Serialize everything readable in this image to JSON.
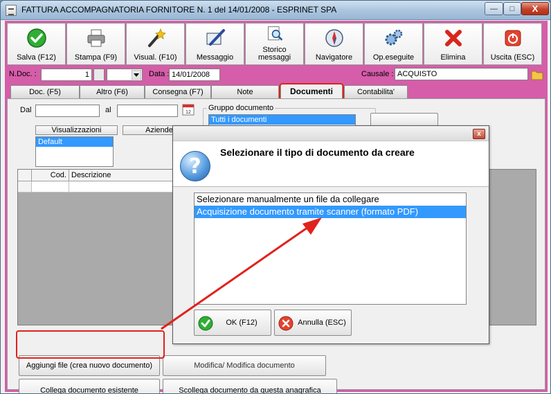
{
  "window": {
    "title": "FATTURA ACCOMPAGNATORIA FORNITORE N. 1  del 14/01/2008 - ESPRINET SPA",
    "minimize_glyph": "—",
    "maximize_glyph": "□",
    "close_glyph": "X"
  },
  "toolbar": {
    "items": [
      {
        "label": "Salva (F12)",
        "icon": "checkmark-icon"
      },
      {
        "label": "Stampa (F9)",
        "icon": "printer-icon"
      },
      {
        "label": "Visual. (F10)",
        "icon": "magic-wand-icon"
      },
      {
        "label": "Messaggio",
        "icon": "pen-icon"
      },
      {
        "label": "Storico",
        "label2": "messaggi",
        "icon": "search-document-icon"
      },
      {
        "label": "Navigatore",
        "icon": "compass-icon"
      },
      {
        "label": "Op.eseguite",
        "icon": "gears-icon"
      },
      {
        "label": "Elimina",
        "icon": "delete-x-icon"
      },
      {
        "label": "Uscita (ESC)",
        "icon": "exit-icon"
      }
    ]
  },
  "fields": {
    "ndoc_label": "N.Doc. :",
    "ndoc_value": "1",
    "data_label": "Data :",
    "data_value": "14/01/2008",
    "causale_label": "Causale :",
    "causale_value": "ACQUISTO"
  },
  "tabs": [
    {
      "label": "Doc. (F5)"
    },
    {
      "label": "Altro (F6)"
    },
    {
      "label": "Consegna (F7)"
    },
    {
      "label": "Note"
    },
    {
      "label": "Documenti",
      "active": true
    },
    {
      "label": "Contabilita'"
    }
  ],
  "panel": {
    "dal_label": "Dal",
    "al_label": "al",
    "gruppo_title": "Gruppo documento",
    "gruppo_selected": "Tutti i documenti",
    "visualizzazioni_header": "Visualizzazioni",
    "aziende_header": "Aziende",
    "visualizzazioni_selected": "Default",
    "grid_headers": [
      "Cod.",
      "Descrizione"
    ],
    "behind_buttons_text": "Modifica/ Modifica documento"
  },
  "buttons": {
    "aggiungi": "Aggiungi file (crea nuovo documento)",
    "collega": "Collega documento esistente",
    "scollega": "Scollega documento da questa anagrafica"
  },
  "dialog": {
    "heading": "Selezionare il tipo di documento da creare",
    "close_glyph": "x",
    "question_glyph": "?",
    "options": [
      {
        "label": "Selezionare manualmente un file da collegare",
        "selected": false
      },
      {
        "label": "Acquisizione documento tramite scanner (formato PDF)",
        "selected": true
      }
    ],
    "ok_label": "OK (F12)",
    "annulla_label": "Annulla (ESC)"
  },
  "colors": {
    "accent_pink": "#d55da9",
    "selection_blue": "#3399ff",
    "highlight_red": "#e0221c"
  }
}
